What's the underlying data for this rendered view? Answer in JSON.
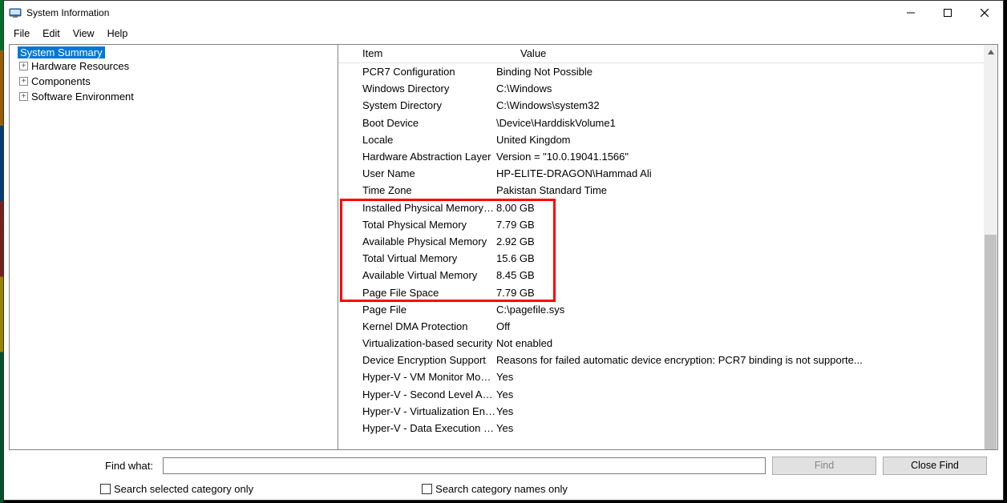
{
  "window": {
    "title": "System Information"
  },
  "menus": [
    "File",
    "Edit",
    "View",
    "Help"
  ],
  "tree": {
    "root": "System Summary",
    "children": [
      "Hardware Resources",
      "Components",
      "Software Environment"
    ]
  },
  "columns": {
    "item": "Item",
    "value": "Value"
  },
  "rows": [
    {
      "item": "PCR7 Configuration",
      "value": "Binding Not Possible"
    },
    {
      "item": "Windows Directory",
      "value": "C:\\Windows"
    },
    {
      "item": "System Directory",
      "value": "C:\\Windows\\system32"
    },
    {
      "item": "Boot Device",
      "value": "\\Device\\HarddiskVolume1"
    },
    {
      "item": "Locale",
      "value": "United Kingdom"
    },
    {
      "item": "Hardware Abstraction Layer",
      "value": "Version = \"10.0.19041.1566\""
    },
    {
      "item": "User Name",
      "value": "HP-ELITE-DRAGON\\Hammad Ali"
    },
    {
      "item": "Time Zone",
      "value": "Pakistan Standard Time"
    },
    {
      "item": "Installed Physical Memory (RAM)",
      "value": "8.00 GB"
    },
    {
      "item": "Total Physical Memory",
      "value": "7.79 GB"
    },
    {
      "item": "Available Physical Memory",
      "value": "2.92 GB"
    },
    {
      "item": "Total Virtual Memory",
      "value": "15.6 GB"
    },
    {
      "item": "Available Virtual Memory",
      "value": "8.45 GB"
    },
    {
      "item": "Page File Space",
      "value": "7.79 GB"
    },
    {
      "item": "Page File",
      "value": "C:\\pagefile.sys"
    },
    {
      "item": "Kernel DMA Protection",
      "value": "Off"
    },
    {
      "item": "Virtualization-based security",
      "value": "Not enabled"
    },
    {
      "item": "Device Encryption Support",
      "value": "Reasons for failed automatic device encryption: PCR7 binding is not supporte..."
    },
    {
      "item": "Hyper-V - VM Monitor Mode E...",
      "value": "Yes"
    },
    {
      "item": "Hyper-V - Second Level Addres...",
      "value": "Yes"
    },
    {
      "item": "Hyper-V - Virtualization Enable...",
      "value": "Yes"
    },
    {
      "item": "Hyper-V - Data Execution Prote...",
      "value": "Yes"
    }
  ],
  "find": {
    "label": "Find what:",
    "value": "",
    "find_btn": "Find",
    "close_btn": "Close Find",
    "cb1": "Search selected category only",
    "cb2": "Search category names only"
  }
}
